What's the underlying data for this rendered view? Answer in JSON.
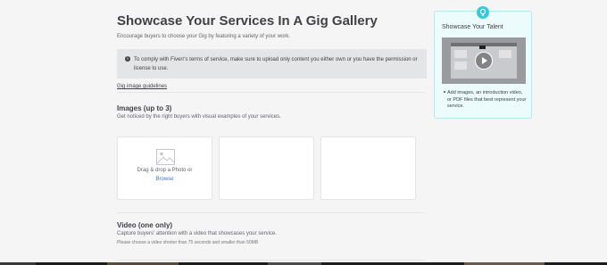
{
  "header": {
    "title": "Showcase Your Services In A Gig Gallery",
    "subtitle": "Encourage buyers to choose your Gig by featuring a variety of your work."
  },
  "notice": {
    "text": "To comply with Fiverr's terms of service, make sure to upload only content you either own or you have the permission or license to use."
  },
  "guidelines_link": "Gig image guidelines",
  "images_section": {
    "title": "Images (up to 3)",
    "description": "Get noticed by the right buyers with visual examples of your services.",
    "upload": {
      "drag_text": "Drag & drop a Photo or",
      "browse_label": "Browse"
    }
  },
  "video_section": {
    "title": "Video (one only)",
    "description": "Capture buyers' attention with a video that showcases your service.",
    "note": "Please choose a video shorter than 75 seconds and smaller than 50MB"
  },
  "tip_card": {
    "title": "Showcase Your Talent",
    "items": [
      "Add images, an introduction video, or PDF files that best represent your service."
    ]
  },
  "icons": {
    "notice": "info-icon",
    "upload": "photo-icon",
    "tip": "lightbulb-icon",
    "video": "play-icon"
  },
  "colors": {
    "accent_link": "#446ee7",
    "tip_background": "#ecfbfc",
    "tip_badge": "#36c9dc"
  }
}
